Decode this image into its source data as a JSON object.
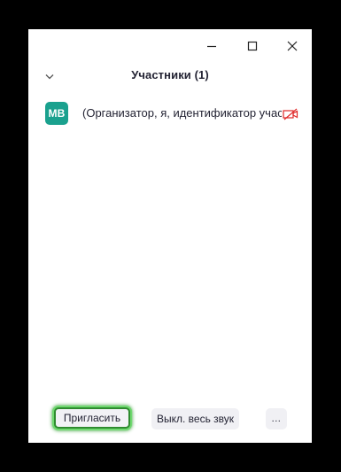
{
  "window_controls": {
    "minimize_icon": "minimize-icon",
    "maximize_icon": "maximize-icon",
    "close_icon": "close-icon"
  },
  "header": {
    "collapse_icon": "chevron-down-icon",
    "title": "Участники (1)"
  },
  "participants": [
    {
      "initials": "MB",
      "avatar_color": "#1aa18e",
      "name": "(Организатор, я, идентификатор учас",
      "video_status_icon": "video-off-icon",
      "video_status_color": "#e02828"
    }
  ],
  "footer": {
    "invite_label": "Пригласить",
    "mute_all_label": "Выкл. весь звук",
    "more_label": "..."
  },
  "colors": {
    "backdrop": "#000000",
    "panel": "#ffffff",
    "highlight": "#2e8b2e"
  }
}
